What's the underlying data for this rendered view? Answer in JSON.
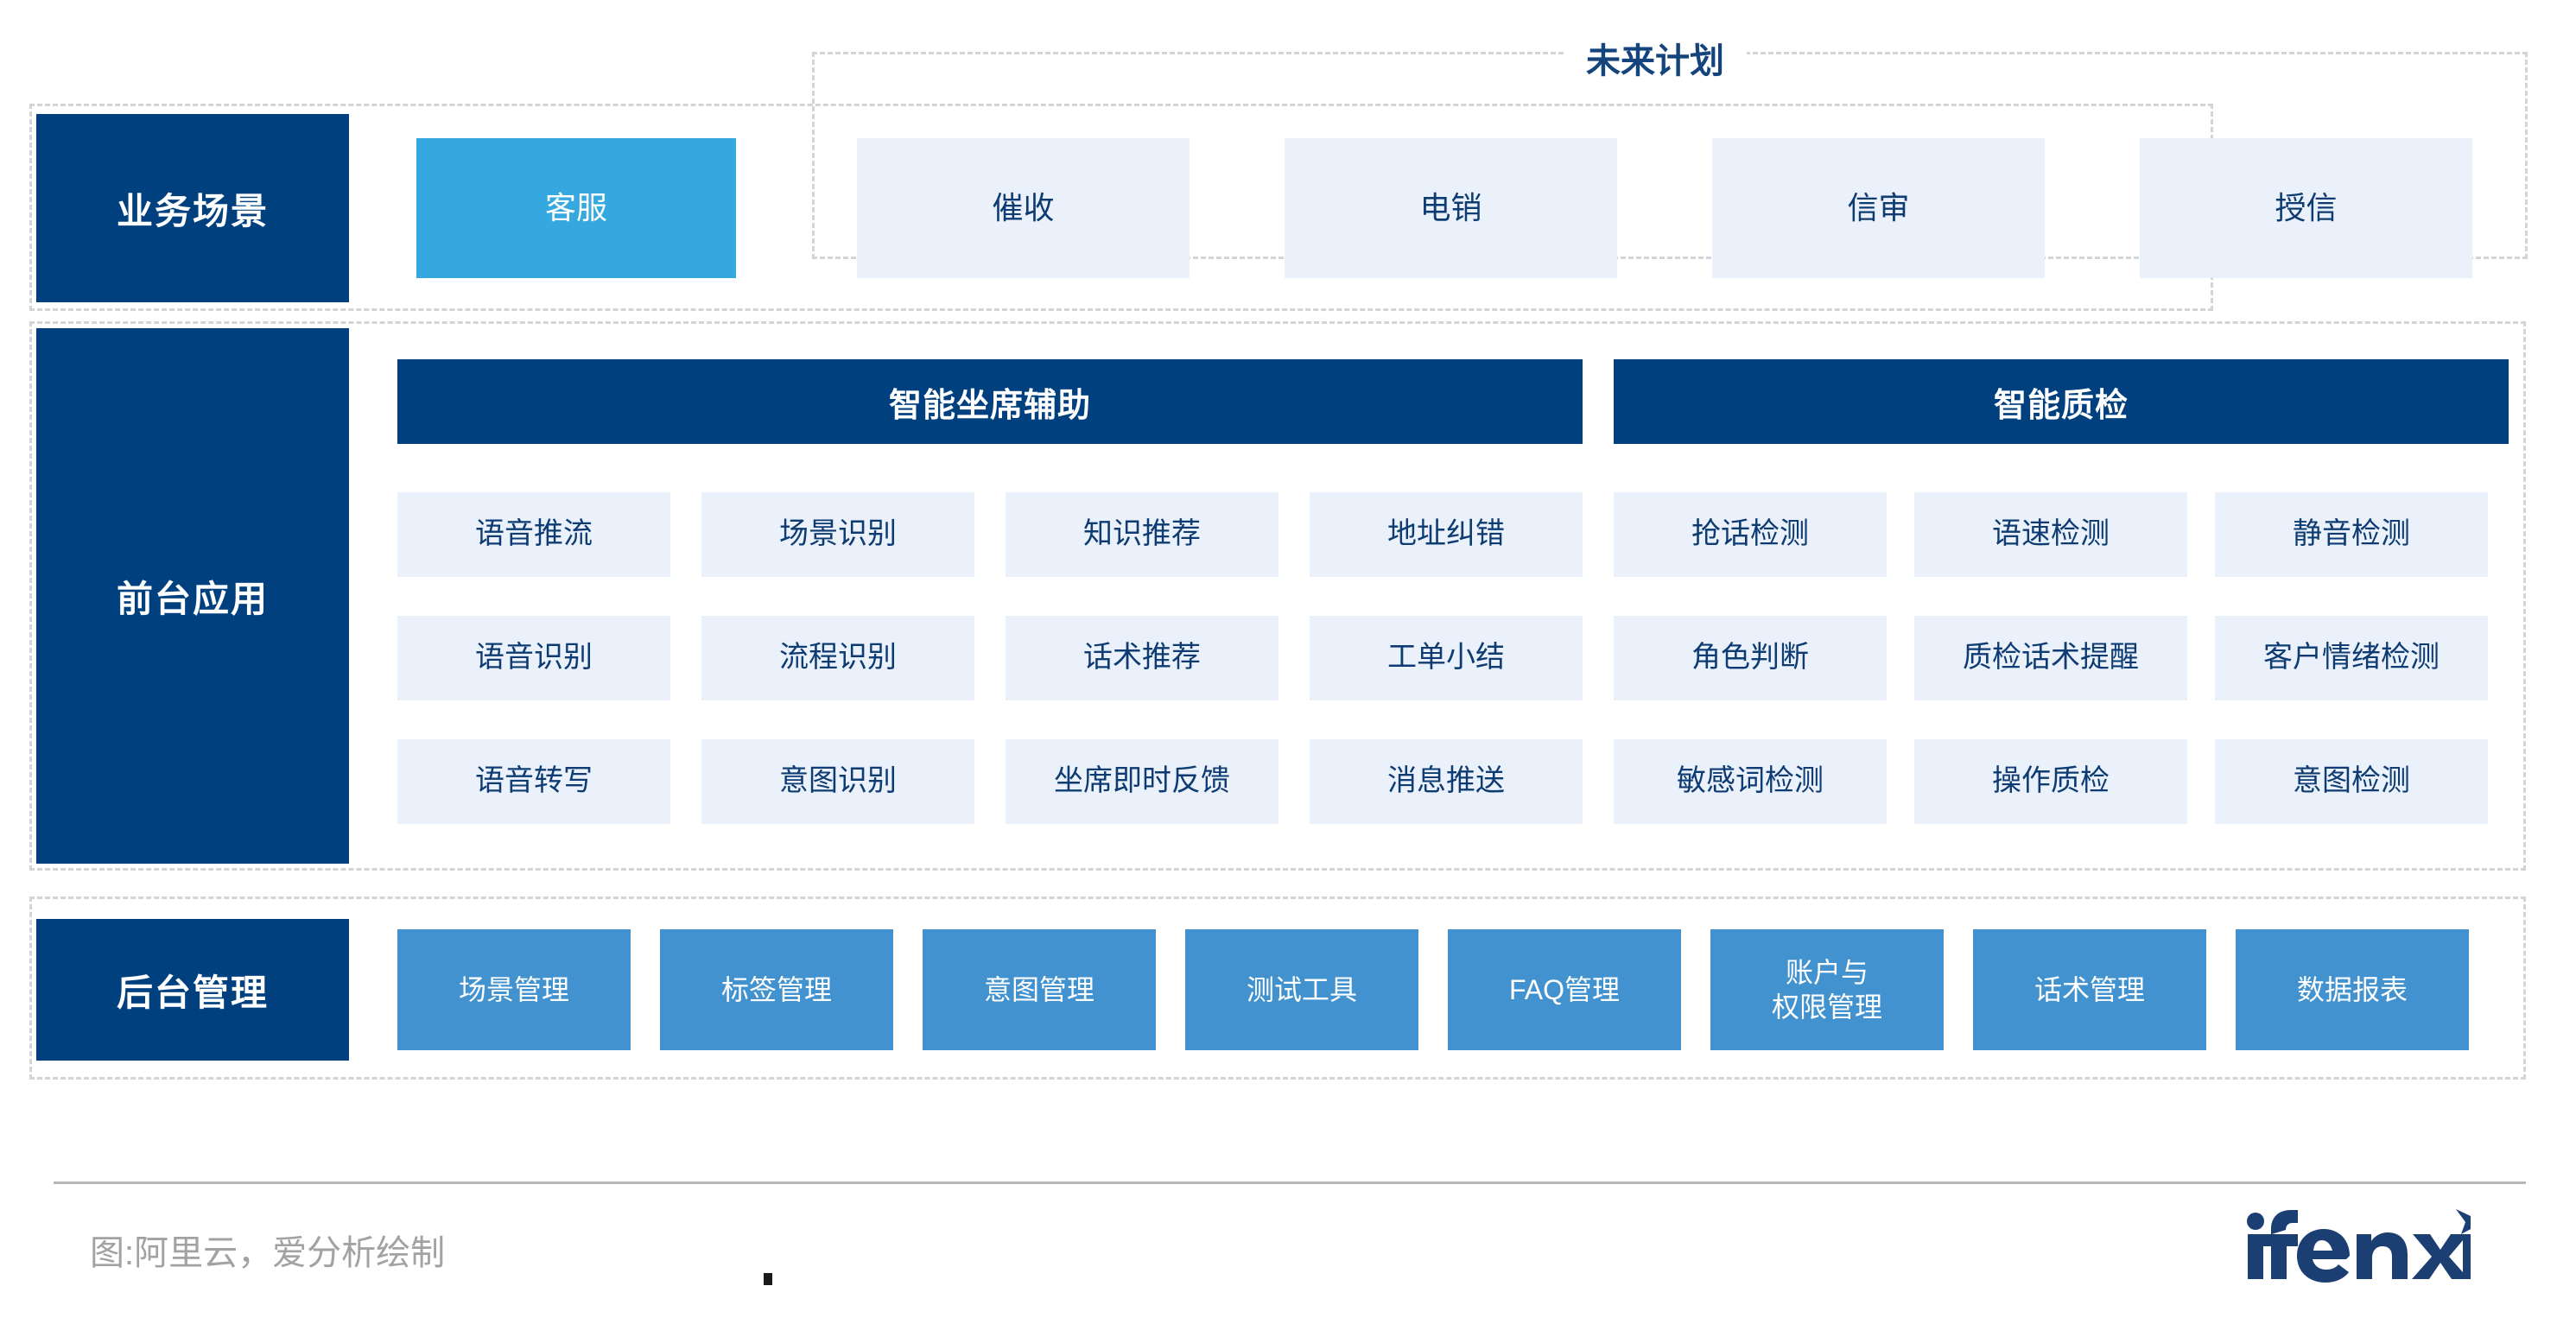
{
  "future_plan": {
    "caption": "未来计划"
  },
  "rows": {
    "scenario": {
      "label": "业务场景",
      "active": {
        "label": "客服"
      },
      "planned": [
        {
          "label": "催收"
        },
        {
          "label": "电销"
        },
        {
          "label": "信审"
        },
        {
          "label": "授信"
        }
      ]
    },
    "frontend": {
      "label": "前台应用",
      "groups": [
        {
          "header": "智能坐席辅助",
          "tiles": [
            "语音推流",
            "场景识别",
            "知识推荐",
            "地址纠错",
            "语音识别",
            "流程识别",
            "话术推荐",
            "工单小结",
            "语音转写",
            "意图识别",
            "坐席即时反馈",
            "消息推送"
          ]
        },
        {
          "header": "智能质检",
          "tiles": [
            "抢话检测",
            "语速检测",
            "静音检测",
            "角色判断",
            "质检话术提醒",
            "客户情绪检测",
            "敏感词检测",
            "操作质检",
            "意图检测"
          ]
        }
      ]
    },
    "backend": {
      "label": "后台管理",
      "tiles": [
        "场景管理",
        "标签管理",
        "意图管理",
        "测试工具",
        "FAQ管理",
        "账户与\n权限管理",
        "话术管理",
        "数据报表"
      ]
    }
  },
  "footer": {
    "credit": "图:阿里云，爱分析绘制",
    "logo_text": "ifenxi"
  },
  "colors": {
    "navy": "#01407f",
    "accent_blue": "#35a8e0",
    "tile_blue": "#4292cf",
    "tile_light": "#eaf1fa",
    "tile_text": "#0d3b72",
    "dash": "#d2d4d6"
  }
}
